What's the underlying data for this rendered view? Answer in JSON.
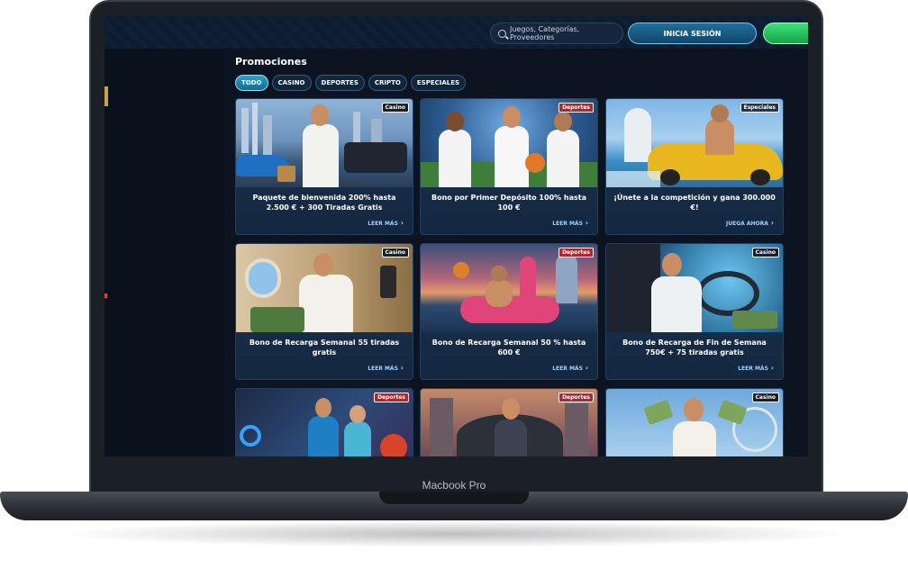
{
  "device": {
    "label": "Macbook Pro"
  },
  "header": {
    "search_placeholder": "Juegos, Categorías, Proveedores",
    "login_label": "INICIA SESIÓN"
  },
  "page": {
    "title": "Promociones"
  },
  "filters": [
    {
      "label": "TODO",
      "active": true
    },
    {
      "label": "CASINO",
      "active": false
    },
    {
      "label": "DEPORTES",
      "active": false
    },
    {
      "label": "CRIPTO",
      "active": false
    },
    {
      "label": "ESPECIALES",
      "active": false
    }
  ],
  "promotions": [
    {
      "badge": "Casino",
      "title": "Paquete de bienvenida 200% hasta 2.500 € + 300 Tiradas Gratis",
      "cta": "LEER MÁS"
    },
    {
      "badge": "Deportes",
      "title": "Bono por Primer Depósito 100% hasta 100 €",
      "cta": "LEER MÁS"
    },
    {
      "badge": "Especiales",
      "title": "¡Únete a la competición y gana 300.000 €!",
      "cta": "JUEGA AHORA"
    },
    {
      "badge": "Casino",
      "title": "Bono de Recarga Semanal 55 tiradas gratis",
      "cta": "LEER MÁS"
    },
    {
      "badge": "Deportes",
      "title": "Bono de Recarga Semanal 50 % hasta 600 €",
      "cta": "LEER MÁS"
    },
    {
      "badge": "Casino",
      "title": "Bono de Recarga de Fin de Semana 750€ + 75 tiradas gratis",
      "cta": "LEER MÁS"
    },
    {
      "badge": "Deportes",
      "title": "",
      "cta": ""
    },
    {
      "badge": "Deportes",
      "title": "",
      "cta": ""
    },
    {
      "badge": "Casino",
      "title": "",
      "cta": ""
    }
  ],
  "colors": {
    "casino_badge": "#1a1f2b",
    "deportes_badge": "#b3262f",
    "especiales_badge": "#1b3554"
  }
}
